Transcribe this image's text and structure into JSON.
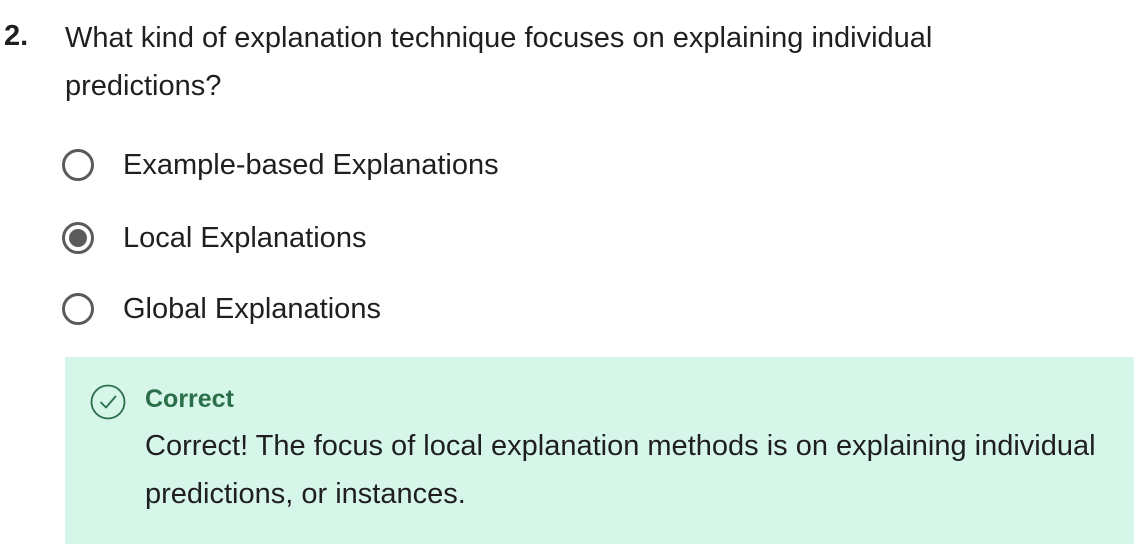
{
  "question": {
    "number": "2.",
    "text": "What kind of explanation technique focuses on explaining individual predictions?"
  },
  "options": [
    {
      "label": "Example-based Explanations",
      "selected": false
    },
    {
      "label": "Local Explanations",
      "selected": true
    },
    {
      "label": "Global Explanations",
      "selected": false
    }
  ],
  "feedback": {
    "status": "Correct",
    "icon": "check-circle-icon",
    "message": "Correct! The focus of local explanation methods is on explaining individual predictions, or instances.",
    "colors": {
      "background": "#d6f6ea",
      "accent": "#2a6e4a"
    }
  }
}
